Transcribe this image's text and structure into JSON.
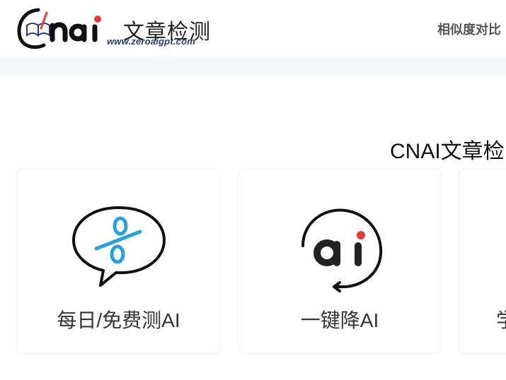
{
  "header": {
    "logo_text_cn": "文章检测",
    "logo_url": "www.zeroaigpt.com",
    "nav_item": "相似度对比"
  },
  "section": {
    "title": "CNAI文章检"
  },
  "cards": [
    {
      "label": "每日/免费测AI",
      "icon": "speech-bubble-percent-icon"
    },
    {
      "label": "一键降AI",
      "icon": "ai-circle-arrow-icon"
    },
    {
      "label": "学",
      "icon": ""
    }
  ],
  "colors": {
    "accent_blue": "#2a9fd8",
    "accent_red": "#e53935",
    "logo_navy": "#23397a"
  }
}
